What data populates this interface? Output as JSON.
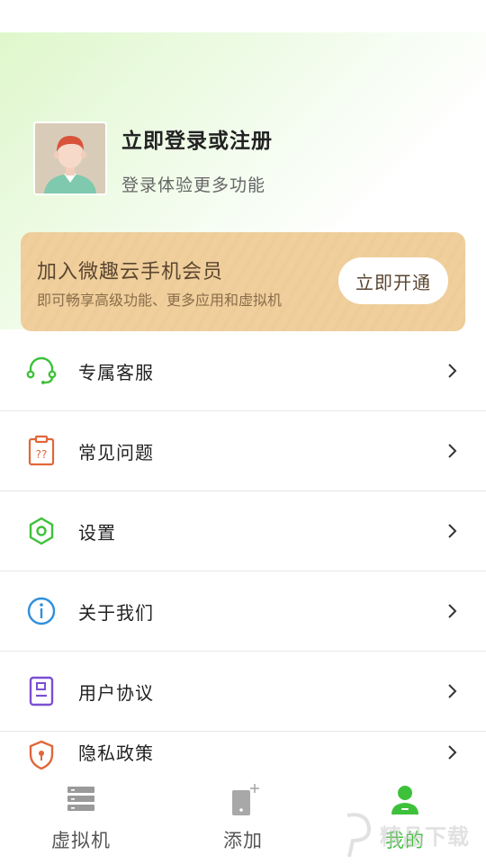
{
  "profile": {
    "login_title": "立即登录或注册",
    "login_subtitle": "登录体验更多功能"
  },
  "vip": {
    "title": "加入微趣云手机会员",
    "subtitle": "即可畅享高级功能、更多应用和虚拟机",
    "button_label": "立即开通"
  },
  "menu": {
    "items": [
      {
        "label": "专属客服",
        "icon": "headset-icon"
      },
      {
        "label": "常见问题",
        "icon": "faq-clipboard-icon"
      },
      {
        "label": "设置",
        "icon": "hexagon-settings-icon"
      },
      {
        "label": "关于我们",
        "icon": "info-icon"
      },
      {
        "label": "用户协议",
        "icon": "agreement-document-icon"
      },
      {
        "label": "隐私政策",
        "icon": "privacy-shield-icon"
      }
    ]
  },
  "tabbar": {
    "tabs": [
      {
        "label": "虚拟机",
        "icon": "server-stack-icon"
      },
      {
        "label": "添加",
        "icon": "add-phone-icon"
      },
      {
        "label": "我的",
        "icon": "user-profile-icon",
        "active": true
      }
    ]
  },
  "watermark": {
    "text": "精品下载"
  },
  "colors": {
    "accent": "#3ec13a",
    "vip_gold": "#f0cf9c",
    "faq_orange": "#e0673a",
    "info_blue": "#2f8fdc",
    "agreement_purple": "#7b4fd0"
  }
}
